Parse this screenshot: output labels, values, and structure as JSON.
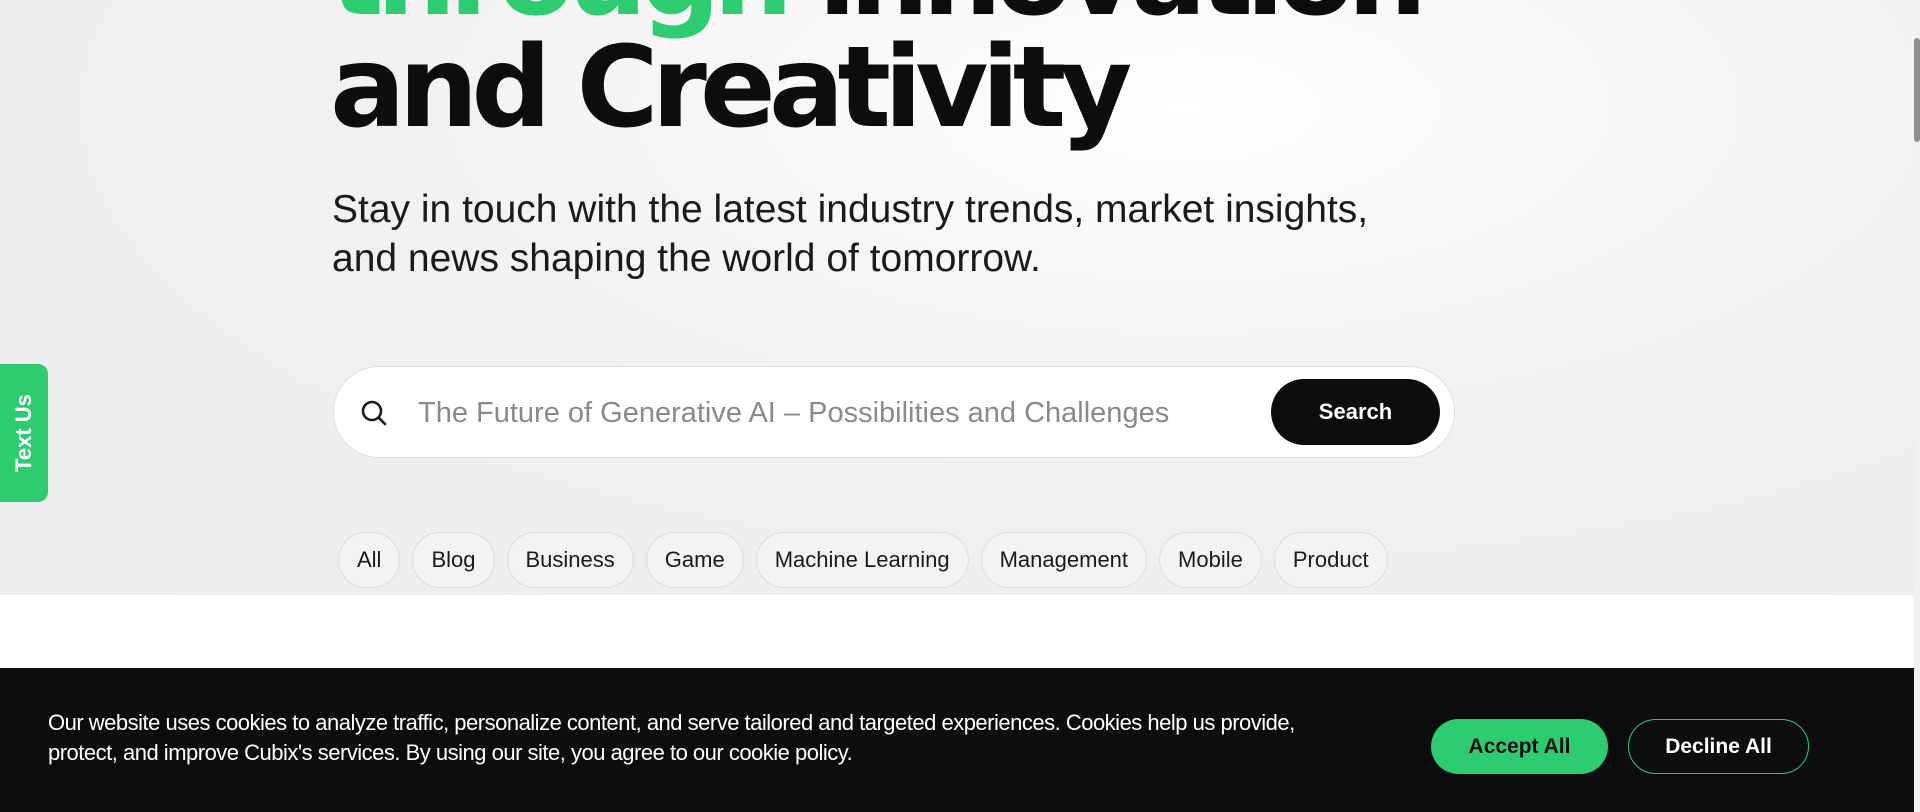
{
  "hero": {
    "headline_line1_accent": "through",
    "headline_line1_rest": " innovation",
    "headline_line2": "and Creativity",
    "subtitle": "Stay in touch with the latest industry trends, market insights, and news shaping the world of tomorrow.",
    "accent_color": "#2ecc71"
  },
  "search": {
    "icon": "search-icon",
    "placeholder": "The Future of Generative AI – Possibilities and Challenges",
    "button_label": "Search"
  },
  "categories": [
    "All",
    "Blog",
    "Business",
    "Game",
    "Machine Learning",
    "Management",
    "Mobile",
    "Product"
  ],
  "side_tab": {
    "label": "Text Us"
  },
  "cookie_banner": {
    "message": "Our website uses cookies to analyze traffic, personalize content, and serve tailored and targeted experiences. Cookies help us provide, protect, and improve Cubix's services. By using our site, you agree to our cookie policy.",
    "accept_label": "Accept All",
    "decline_label": "Decline All"
  }
}
